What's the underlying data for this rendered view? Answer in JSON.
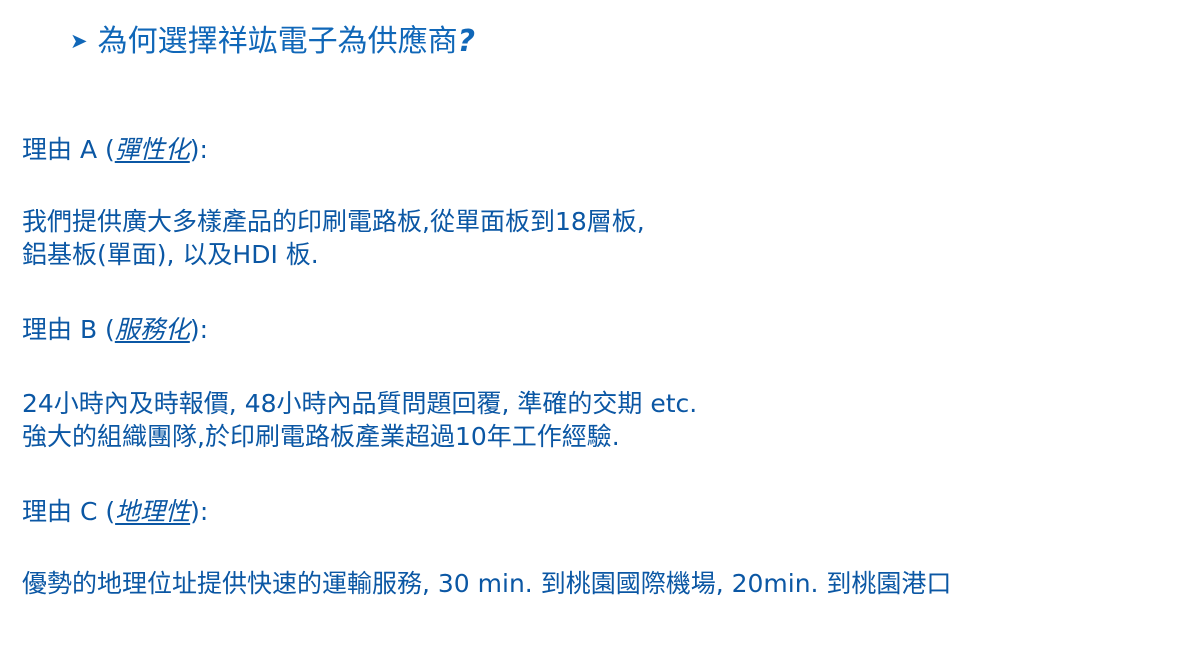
{
  "heading": {
    "bullet_icon": "arrow-bullet-icon",
    "text": "為何選擇祥竑電子為供應商",
    "question_mark": "?"
  },
  "reasons": [
    {
      "label_prefix": "理由 A (",
      "term": "彈性化",
      "label_suffix": "):",
      "lines": [
        "我們提供廣大多樣產品的印刷電路板,從單面板到18層板,",
        "鋁基板(單面), 以及HDI 板."
      ]
    },
    {
      "label_prefix": "理由 B (",
      "term": "服務化",
      "label_suffix": "):",
      "lines": [
        "24小時內及時報價, 48小時內品質問題回覆, 準確的交期 etc.",
        "強大的組織團隊,於印刷電路板產業超過10年工作經驗."
      ]
    },
    {
      "label_prefix": "理由 C (",
      "term": "地理性",
      "label_suffix": "):",
      "lines": [
        "優勢的地理位址提供快速的運輸服務, 30 min. 到桃園國際機場, 20min. 到桃園港口"
      ]
    }
  ],
  "colors": {
    "heading": "#1067b8",
    "body_text": "#0b57a4",
    "background": "#ffffff"
  }
}
